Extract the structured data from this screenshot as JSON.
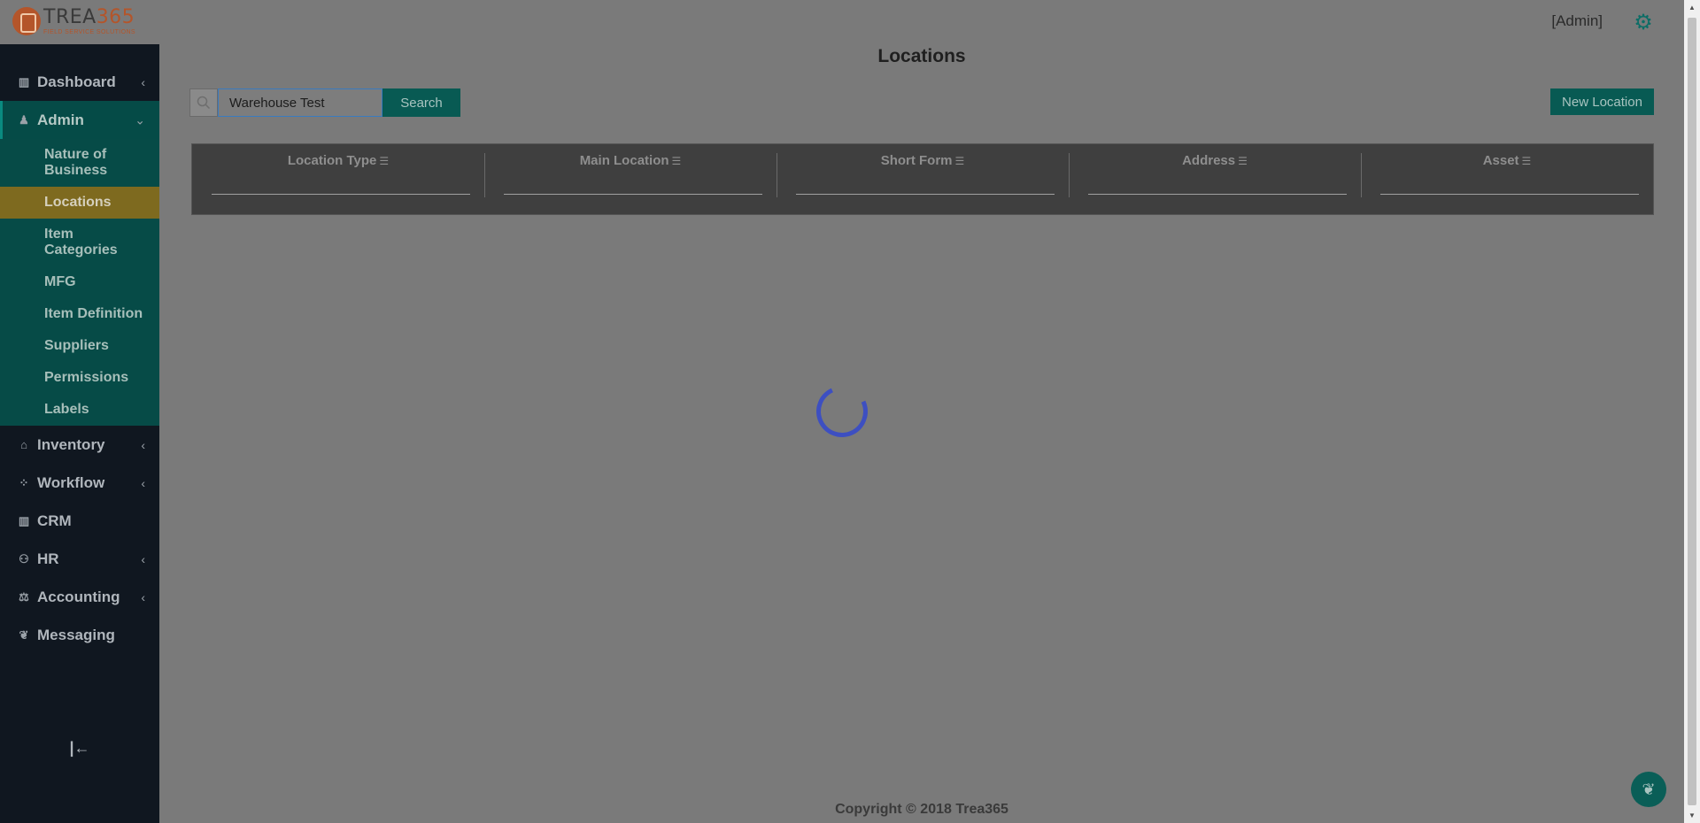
{
  "brand": {
    "name_prefix": "TREA",
    "name_suffix": "365",
    "tagline": "FIELD SERVICE SOLUTIONS"
  },
  "header": {
    "user_label": "[Admin]",
    "settings_icon": "gear-icon",
    "accent": "#0d6d66"
  },
  "sidebar": {
    "items": [
      {
        "label": "Dashboard",
        "icon": "bar-chart-icon"
      },
      {
        "label": "Admin",
        "icon": "user-icon"
      },
      {
        "label": "Inventory",
        "icon": "home-icon"
      },
      {
        "label": "Workflow",
        "icon": "workflow-icon"
      },
      {
        "label": "CRM",
        "icon": "bar-chart-icon"
      },
      {
        "label": "HR",
        "icon": "users-icon"
      },
      {
        "label": "Accounting",
        "icon": "scale-icon"
      },
      {
        "label": "Messaging",
        "icon": "chat-icon"
      }
    ],
    "admin_sub": [
      "Nature of Business",
      "Locations",
      "Item Categories",
      "MFG",
      "Item Definition",
      "Suppliers",
      "Permissions",
      "Labels"
    ],
    "active_sub": "Locations",
    "collapse_glyph": "|←"
  },
  "main": {
    "title": "Locations",
    "search": {
      "value": "Warehouse Test",
      "button_label": "Search"
    },
    "new_button_label": "New Location",
    "columns": [
      "Location Type",
      "Main Location",
      "Short Form",
      "Address",
      "Asset"
    ],
    "loading": true
  },
  "footer": {
    "copyright": "Copyright © 2018 Trea365"
  }
}
